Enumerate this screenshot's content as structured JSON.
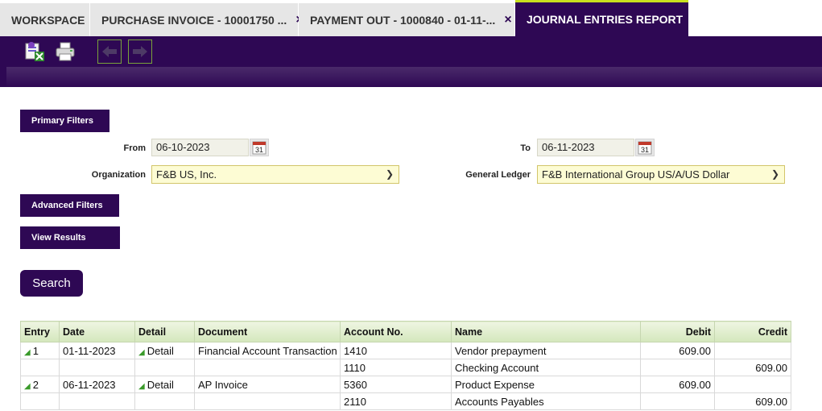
{
  "tabs": [
    {
      "label": "WORKSPACE",
      "closable": false
    },
    {
      "label": "PURCHASE INVOICE - 10001750 ...",
      "closable": true
    },
    {
      "label": "PAYMENT OUT - 1000840 - 01-11-...",
      "closable": true
    },
    {
      "label": "JOURNAL ENTRIES REPORT",
      "closable": true,
      "active": true
    }
  ],
  "close_glyph": "×",
  "toolbar": [
    "export-excel-icon",
    "print-icon",
    "previous-arrow-icon",
    "next-arrow-icon"
  ],
  "filters": {
    "primary_label": "Primary Filters",
    "from_label": "From",
    "from_value": "06-10-2023",
    "to_label": "To",
    "to_value": "06-11-2023",
    "calendar_day": "31",
    "org_label": "Organization",
    "org_value": "F&B US, Inc.",
    "gl_label": "General Ledger",
    "gl_value": "F&B International Group US/A/US Dollar",
    "advanced_label": "Advanced Filters",
    "view_label": "View Results",
    "search_label": "Search"
  },
  "table": {
    "headers": [
      "Entry",
      "Date",
      "Detail",
      "Document",
      "Account No.",
      "Name",
      "Debit",
      "Credit"
    ],
    "rows": [
      {
        "entry": "1",
        "date": "01-11-2023",
        "detail": "Detail",
        "document": "Financial Account Transaction",
        "account": "1410",
        "name": "Vendor prepayment",
        "debit": "609.00",
        "credit": ""
      },
      {
        "entry": "",
        "date": "",
        "detail": "",
        "document": "",
        "account": "1110",
        "name": "Checking Account",
        "debit": "",
        "credit": "609.00"
      },
      {
        "entry": "2",
        "date": "06-11-2023",
        "detail": "Detail",
        "document": "AP Invoice",
        "account": "5360",
        "name": "Product Expense",
        "debit": "609.00",
        "credit": ""
      },
      {
        "entry": "",
        "date": "",
        "detail": "",
        "document": "",
        "account": "2110",
        "name": "Accounts Payables",
        "debit": "",
        "credit": "609.00"
      }
    ]
  },
  "colors": {
    "brand": "#2e0854",
    "accent": "#c8e01e",
    "header_green": "#d4e7bc",
    "select_yellow": "#fdfcd4"
  }
}
